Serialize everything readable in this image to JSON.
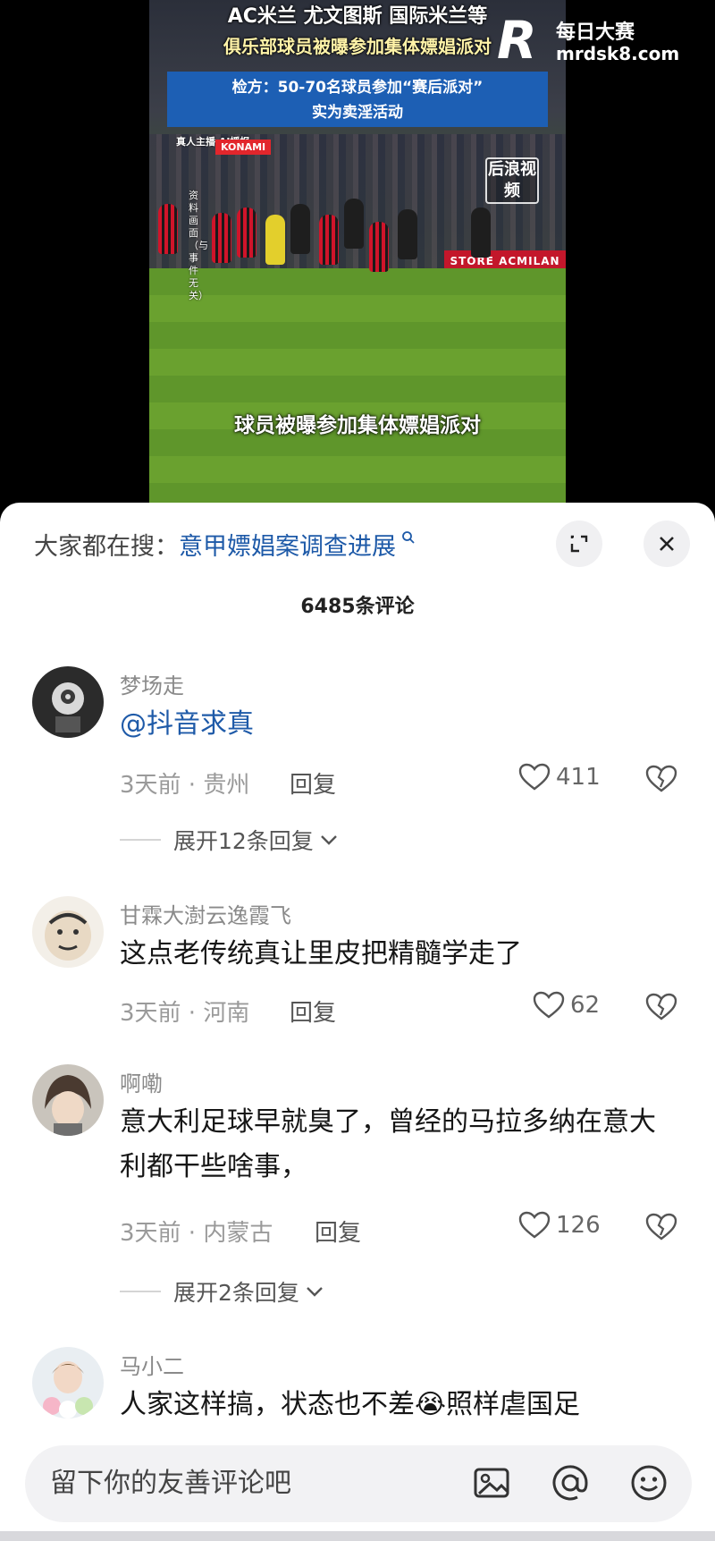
{
  "video": {
    "headline_1": "AC米兰 尤文图斯 国际米兰等",
    "headline_2": "俱乐部球员被曝参加集体嫖娼派对",
    "info_line_1": "检方：50-70名球员参加“赛后派对”",
    "info_line_2": "实为卖淫活动",
    "tag_left": "真人主播 AI播报",
    "tag_red": "KONAMI",
    "vertical_note": "资料画面（与事件无关）",
    "brand": "后浪视频",
    "board_text": "STORE ACMILAN",
    "subtitle": "球员被曝参加集体嫖娼派对",
    "watermark_title": "每日大赛",
    "watermark_url": "mrdsk8.com"
  },
  "sheet": {
    "search_prefix": "大家都在搜：",
    "search_term": "意甲嫖娼案调查进展",
    "comment_count": "6485条评论"
  },
  "comments": [
    {
      "user": "梦场走",
      "text": "@抖音求真",
      "time": "3天前 · 贵州",
      "reply": "回复",
      "likes": "411",
      "expand": "展开12条回复"
    },
    {
      "user": "甘霖大澍云逸霞飞",
      "text": "这点老传统真让里皮把精髓学走了",
      "time": "3天前 · 河南",
      "reply": "回复",
      "likes": "62"
    },
    {
      "user": "啊嘞",
      "text": "意大利足球早就臭了，曾经的马拉多纳在意大利都干些啥事，",
      "time": "3天前 · 内蒙古",
      "reply": "回复",
      "likes": "126",
      "expand": "展开2条回复"
    },
    {
      "user": "马小二",
      "text": "人家这样搞，状态也不差😭照样虐国足"
    }
  ],
  "input": {
    "placeholder": "留下你的友善评论吧"
  },
  "icons": [
    "search-icon",
    "expand-icon",
    "close-icon",
    "heart-icon",
    "broken-heart-icon",
    "chevron-down-icon",
    "image-icon",
    "at-icon",
    "emoji-icon"
  ]
}
